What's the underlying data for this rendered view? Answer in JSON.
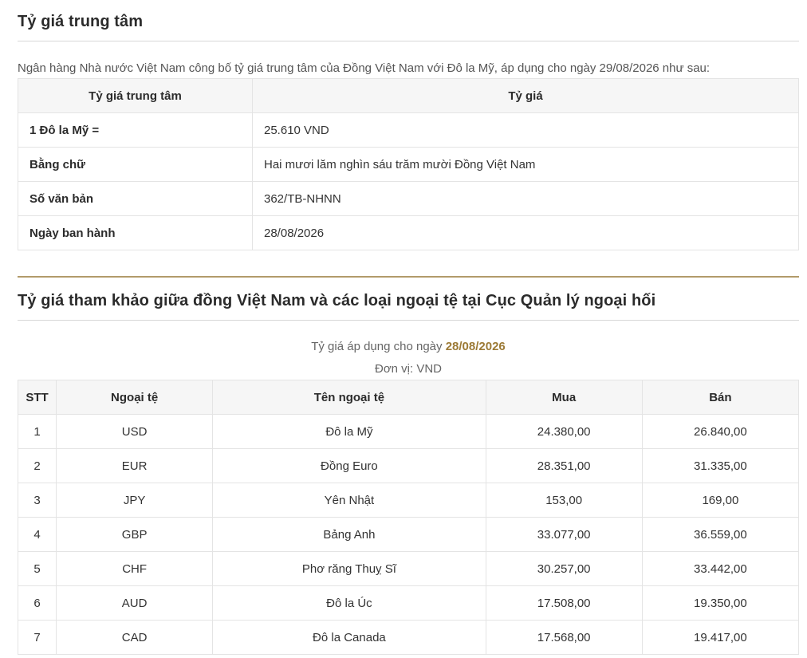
{
  "central_rate": {
    "title": "Tỷ giá trung tâm",
    "intro": "Ngân hàng Nhà nước Việt Nam công bố tỷ giá trung tâm của Đồng Việt Nam với Đô la Mỹ, áp dụng cho ngày 29/08/2026 như sau:",
    "headers": [
      "Tỷ giá trung tâm",
      "Tỷ giá"
    ],
    "rows": [
      {
        "label": "1 Đô la Mỹ =",
        "value": "25.610 VND"
      },
      {
        "label": "Bằng chữ",
        "value": "Hai mươi lăm nghìn sáu trăm mười Đồng Việt Nam"
      },
      {
        "label": "Số văn bản",
        "value": "362/TB-NHNN"
      },
      {
        "label": "Ngày ban hành",
        "value": "28/08/2026"
      }
    ]
  },
  "reference_rates": {
    "title": "Tỷ giá tham khảo giữa đồng Việt Nam và các loại ngoại tệ tại Cục Quản lý ngoại hối",
    "applied_prefix": "Tỷ giá áp dụng cho ngày",
    "applied_date": "28/08/2026",
    "unit": "Đơn vị: VND",
    "headers": [
      "STT",
      "Ngoại tệ",
      "Tên ngoại tệ",
      "Mua",
      "Bán"
    ],
    "rows": [
      {
        "stt": "1",
        "code": "USD",
        "name": "Đô la Mỹ",
        "buy": "24.380,00",
        "sell": "26.840,00"
      },
      {
        "stt": "2",
        "code": "EUR",
        "name": "Đồng Euro",
        "buy": "28.351,00",
        "sell": "31.335,00"
      },
      {
        "stt": "3",
        "code": "JPY",
        "name": "Yên Nhật",
        "buy": "153,00",
        "sell": "169,00"
      },
      {
        "stt": "4",
        "code": "GBP",
        "name": "Bảng Anh",
        "buy": "33.077,00",
        "sell": "36.559,00"
      },
      {
        "stt": "5",
        "code": "CHF",
        "name": "Phơ răng Thuỵ Sĩ",
        "buy": "30.257,00",
        "sell": "33.442,00"
      },
      {
        "stt": "6",
        "code": "AUD",
        "name": "Đô la Úc",
        "buy": "17.508,00",
        "sell": "19.350,00"
      },
      {
        "stt": "7",
        "code": "CAD",
        "name": "Đô la Canada",
        "buy": "17.568,00",
        "sell": "19.417,00"
      }
    ]
  },
  "colors": {
    "accent_gold": "#b29a6a",
    "date_highlight": "#9c7a36",
    "header_bg": "#f6f6f6",
    "border": "#e4e4e4"
  }
}
